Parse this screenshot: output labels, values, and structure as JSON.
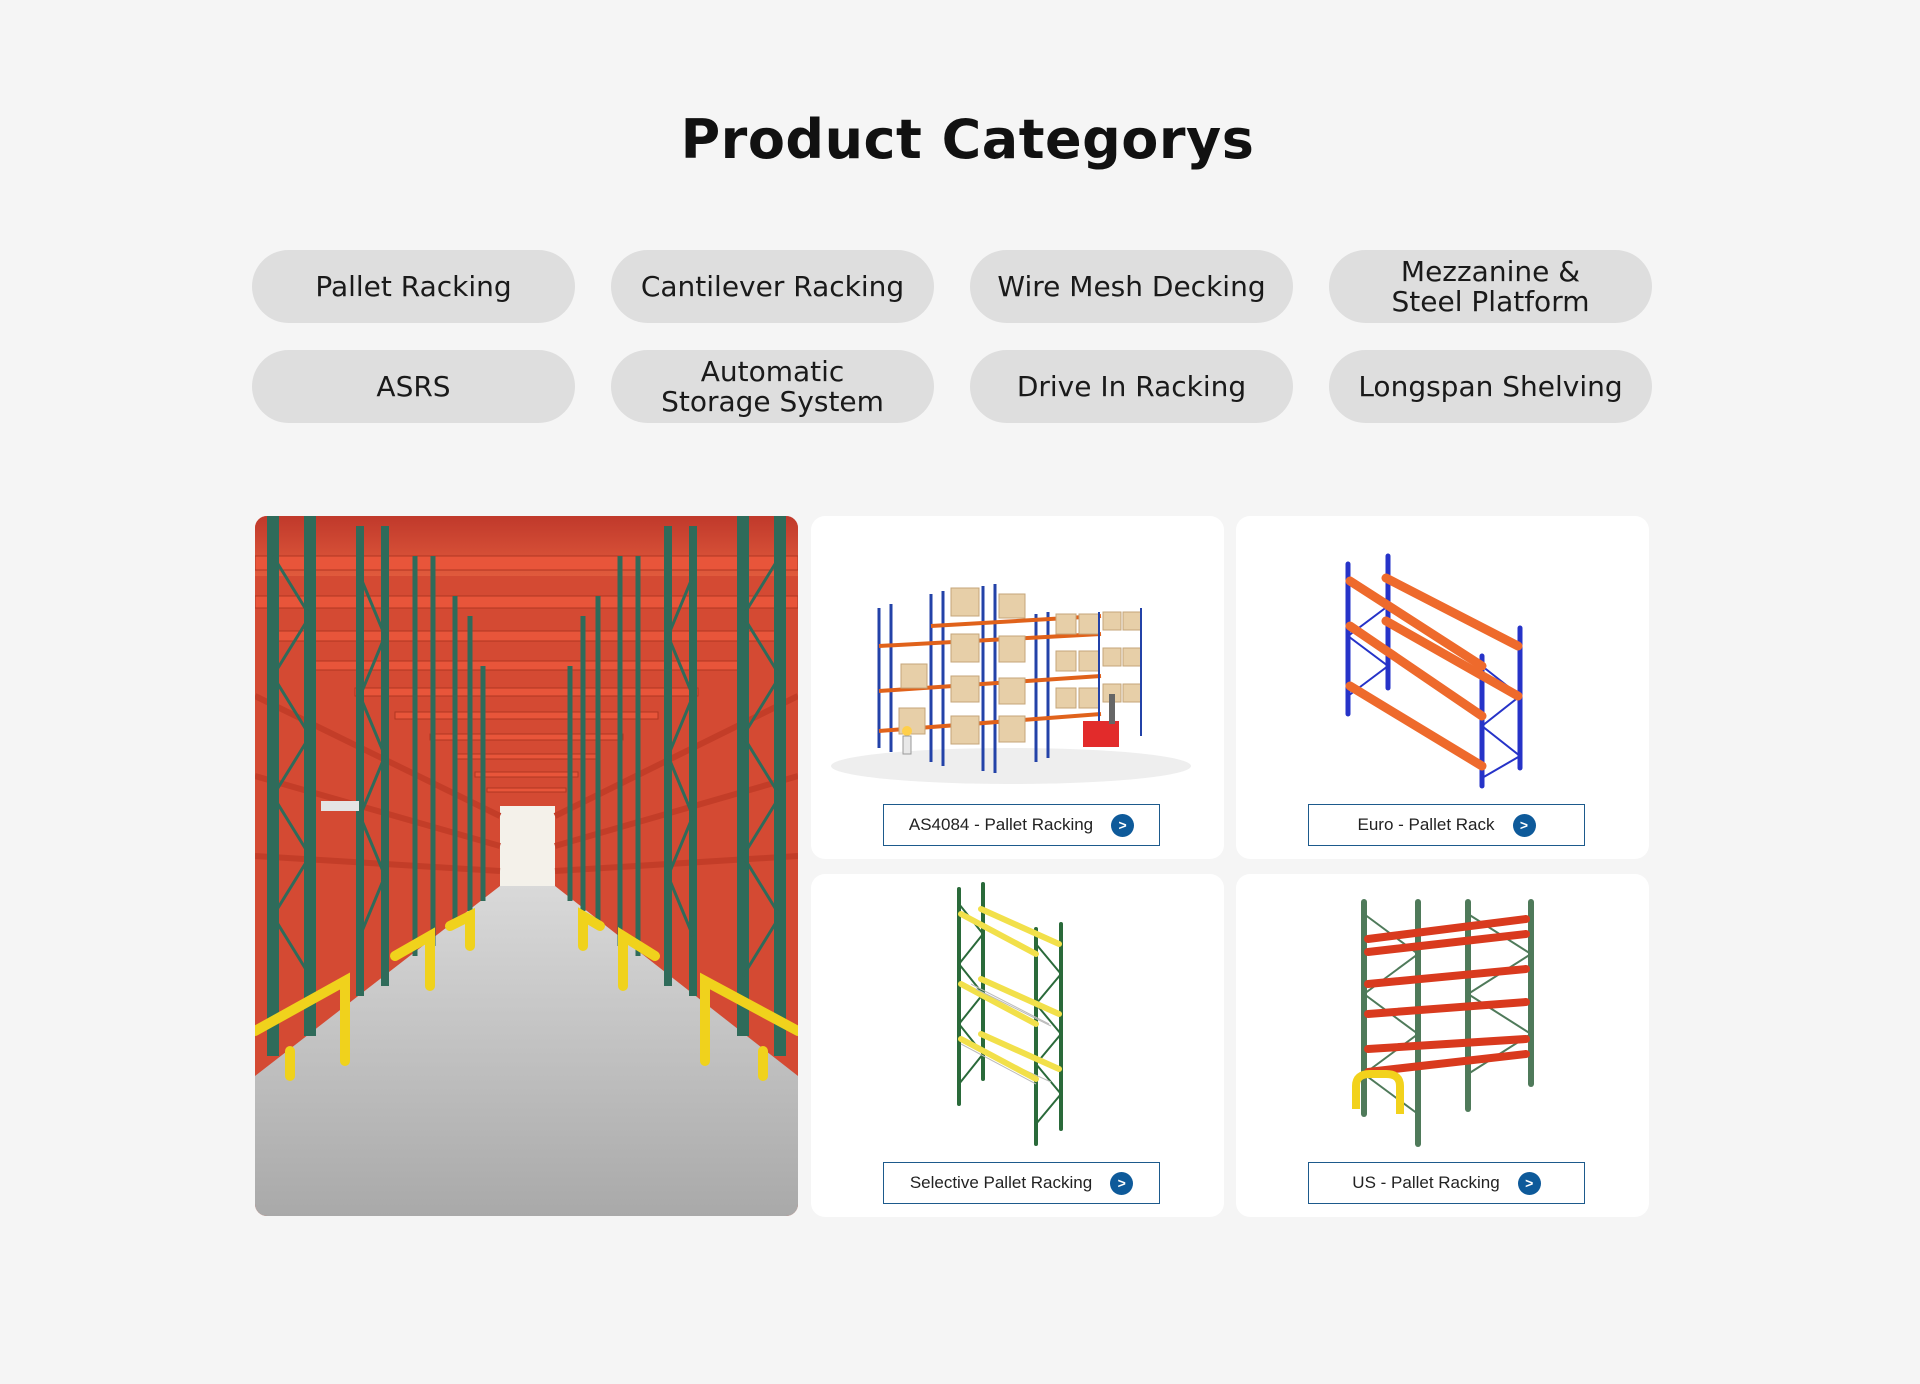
{
  "page": {
    "title": "Product Categorys"
  },
  "categories": [
    {
      "label": "Pallet Racking"
    },
    {
      "label": "Cantilever Racking"
    },
    {
      "label": "Wire Mesh Decking"
    },
    {
      "label": "Mezzanine &\nSteel Platform"
    },
    {
      "label": "ASRS"
    },
    {
      "label": "Automatic\nStorage System"
    },
    {
      "label": "Drive In Racking"
    },
    {
      "label": "Longspan Shelving"
    }
  ],
  "products": [
    {
      "label": "AS4084 - Pallet Racking",
      "icon": "chevron-right-icon"
    },
    {
      "label": "Euro - Pallet Rack",
      "icon": "chevron-right-icon"
    },
    {
      "label": "Selective Pallet Racking",
      "icon": "chevron-right-icon"
    },
    {
      "label": "US - Pallet Racking",
      "icon": "chevron-right-icon"
    }
  ],
  "arrow_glyph": ">",
  "colors": {
    "accent": "#0e5a9a",
    "pill": "#dedede",
    "background": "#f5f5f5",
    "border": "#1d5a8c"
  }
}
